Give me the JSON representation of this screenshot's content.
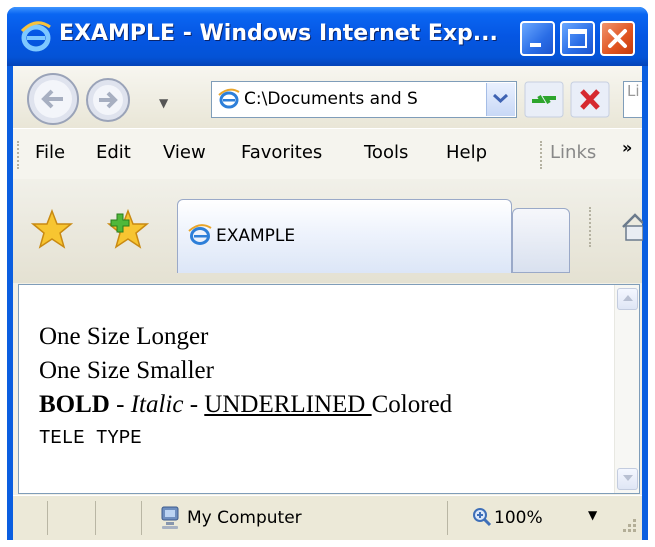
{
  "window": {
    "title": "EXAMPLE - Windows Internet Exp..."
  },
  "address_bar": {
    "value": "C:\\Documents and S"
  },
  "search": {
    "placeholder": "Li"
  },
  "menu": {
    "items": [
      "File",
      "Edit",
      "View",
      "Favorites",
      "Tools",
      "Help"
    ],
    "links_label": "Links",
    "overflow": "»"
  },
  "tabs": [
    {
      "label": "EXAMPLE"
    }
  ],
  "content": {
    "line1": "One Size Longer",
    "line2": "One Size Smaller",
    "bold": "BOLD",
    "sep1": " - ",
    "italic": "Italic",
    "sep2": " - ",
    "underlined": "UNDERLINED ",
    "colored": "Colored",
    "teletype": "TELE TYPE"
  },
  "status": {
    "zone": "My Computer",
    "zoom": "100%"
  },
  "colors": {
    "titlebar": "#0556e3",
    "close_button": "#e0531f",
    "chrome": "#ece9d8"
  }
}
